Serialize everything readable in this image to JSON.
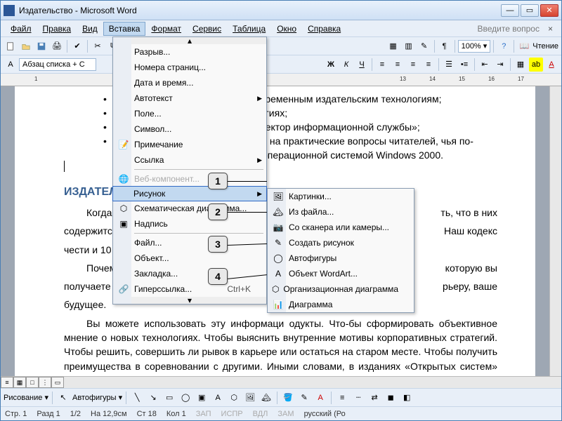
{
  "window": {
    "title": "Издательство - Microsoft Word"
  },
  "menubar": {
    "items": [
      "Файл",
      "Правка",
      "Вид",
      "Вставка",
      "Формат",
      "Сервис",
      "Таблица",
      "Окно",
      "Справка"
    ],
    "ask": "Введите вопрос"
  },
  "toolbar2": {
    "style": "Абзац списка + С",
    "zoom": "100%",
    "reading": "Чтение"
  },
  "insert_menu": {
    "items": [
      {
        "label": "Разрыв..."
      },
      {
        "label": "Номера страниц..."
      },
      {
        "label": "Дата и время..."
      },
      {
        "label": "Автотекст",
        "sub": true
      },
      {
        "label": "Поле..."
      },
      {
        "label": "Символ..."
      },
      {
        "label": "Примечание",
        "icon": "note"
      },
      {
        "label": "Ссылка",
        "sub": true
      },
      {
        "label": "Веб-компонент...",
        "disabled": true,
        "icon": "web"
      },
      {
        "label": "Рисунок",
        "sub": true,
        "highlight": true
      },
      {
        "label": "Схематическая диаграмма...",
        "icon": "diag"
      },
      {
        "label": "Надпись",
        "icon": "textbox"
      },
      {
        "label": "Файл..."
      },
      {
        "label": "Объект..."
      },
      {
        "label": "Закладка..."
      },
      {
        "label": "Гиперссылка...",
        "icon": "link",
        "shortcut": "Ctrl+K"
      }
    ]
  },
  "picture_submenu": {
    "items": [
      {
        "label": "Картинки...",
        "icon": "clip"
      },
      {
        "label": "Из файла...",
        "icon": "file"
      },
      {
        "label": "Со сканера или камеры...",
        "icon": "scan"
      },
      {
        "label": "Создать рисунок",
        "icon": "new"
      },
      {
        "label": "Автофигуры",
        "icon": "shapes"
      },
      {
        "label": "Объект WordArt...",
        "icon": "wa"
      },
      {
        "label": "Организационная диаграмма",
        "icon": "org"
      },
      {
        "label": "Диаграмма",
        "icon": "chart"
      }
    ]
  },
  "doc": {
    "b1": "временным издательским технологиям;",
    "b2": "огиях;",
    "b3": "ректор информационной службы»;",
    "b4a": "ы на практические вопросы читателей, чья по-",
    "b4b": "операционной системой Windows 2000.",
    "h": "ИЗДАТЕЛ",
    "p1a": "Когда",
    "p1b": "ть, что в них",
    "p2a": "содержится",
    "p2b": "Наш кодекс",
    "p3": "чести и 10 его",
    "p4a": "Почем",
    "p4b": "которую вы",
    "p5a": "получаете из",
    "p5b": "рьеру, ваше",
    "p6": "будущее.",
    "p7": "Вы можете использовать эту информаци                                                      одукты.  Что-бы сформировать объективное мнение о новых технологиях. Чтобы выяснить внутренние мотивы корпоративных стратегий. Чтобы решить, совершить ли рывок в карьере или остаться на старом месте. Чтобы получить преимущества в соревновании с другими. Иными словами, в изданиях «Открытых систем» вы найдете информацию, которой живут профессионалы всего мира."
  },
  "callouts": [
    "1",
    "2",
    "3",
    "4"
  ],
  "ruler": [
    "1",
    "13",
    "14",
    "15",
    "16",
    "17"
  ],
  "drawbar": {
    "draw": "Рисование",
    "autoshapes": "Автофигуры"
  },
  "status": {
    "page": "Стр. 1",
    "sec": "Разд 1",
    "pages": "1/2",
    "pos": "На 12,9см",
    "line": "Ст 18",
    "col": "Кол 1",
    "rec": "ЗАП",
    "trk": "ИСПР",
    "ext": "ВДЛ",
    "ovr": "ЗАМ",
    "lang": "русский (Ро"
  }
}
